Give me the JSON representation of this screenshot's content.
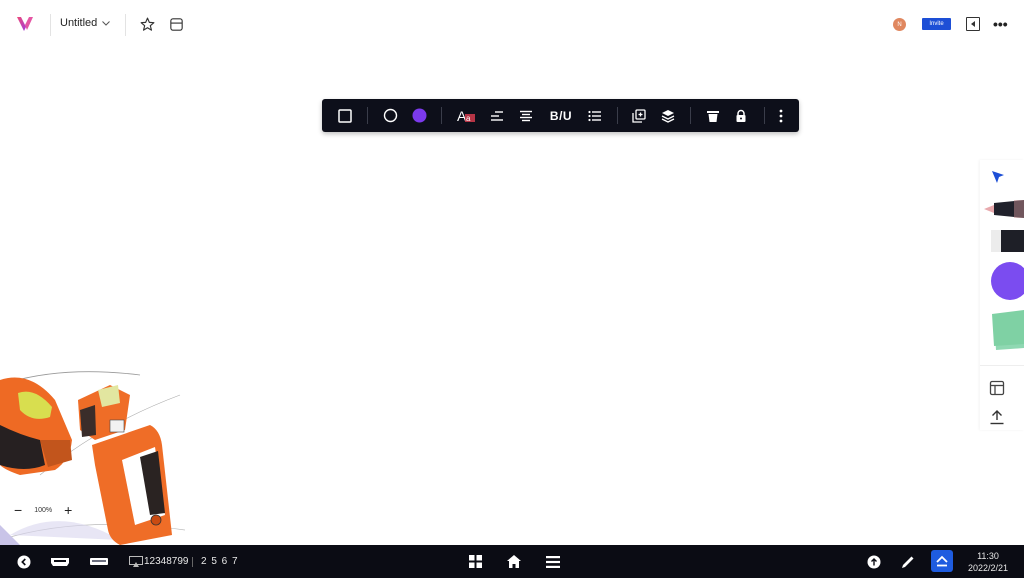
{
  "header": {
    "doc_title": "Untitled",
    "avatar_initial": "N",
    "invite_label": "Invite",
    "icons": {
      "logo": "app-logo-icon",
      "title_dropdown": "chevron-down-icon",
      "favorite": "star-icon",
      "board": "board-icon",
      "panel": "panel-toggle-icon",
      "more": "more-horizontal-icon"
    }
  },
  "toolbar": {
    "items": [
      {
        "name": "border-style",
        "icon": "square-outline-icon"
      },
      {
        "name": "shape-circle",
        "icon": "circle-outline-icon"
      },
      {
        "name": "fill-color",
        "icon": "color-swatch-icon",
        "color": "#7c3aed"
      },
      {
        "name": "text-style",
        "icon": "font-style-icon"
      },
      {
        "name": "line-spacing",
        "icon": "line-spacing-icon"
      },
      {
        "name": "text-align",
        "icon": "align-center-icon"
      },
      {
        "name": "bold-italic-underline",
        "label": "B/U"
      },
      {
        "name": "list",
        "icon": "list-icon"
      },
      {
        "name": "duplicate",
        "icon": "duplicate-icon"
      },
      {
        "name": "layers",
        "icon": "layers-icon"
      },
      {
        "name": "delete",
        "icon": "trash-icon"
      },
      {
        "name": "lock",
        "icon": "lock-icon"
      },
      {
        "name": "more",
        "icon": "more-vertical-icon"
      }
    ],
    "fill_color": "#7c3aed"
  },
  "rail": {
    "tools": [
      {
        "name": "select",
        "icon": "cursor-arrow-icon",
        "color": "#1d4fd6"
      },
      {
        "name": "pen",
        "icon": "pen-icon",
        "color": "#e8a9ad"
      },
      {
        "name": "eraser",
        "icon": "eraser-icon"
      },
      {
        "name": "shape",
        "icon": "circle-shape-icon",
        "color": "#7b4cf0"
      },
      {
        "name": "sticky-note",
        "icon": "sticky-note-icon",
        "color": "#7fd1a4"
      },
      {
        "name": "template",
        "icon": "layout-icon"
      },
      {
        "name": "upload",
        "icon": "upload-icon"
      }
    ]
  },
  "canvas": {
    "zoom_level": "100%",
    "zoom_out": "−",
    "zoom_in": "+"
  },
  "taskbar": {
    "meeting_id": "12348799",
    "code": "2 5 6 7",
    "time": "11:30",
    "date": "2022/2/21",
    "icons": {
      "back": "back-icon",
      "hdmi": "hdmi-icon",
      "usb": "usb-icon",
      "cast": "screen-cast-icon",
      "apps": "apps-grid-icon",
      "home": "home-icon",
      "menu": "menu-icon",
      "upload": "upload-circle-icon",
      "annotate": "pen-icon",
      "eject": "eject-icon"
    }
  }
}
